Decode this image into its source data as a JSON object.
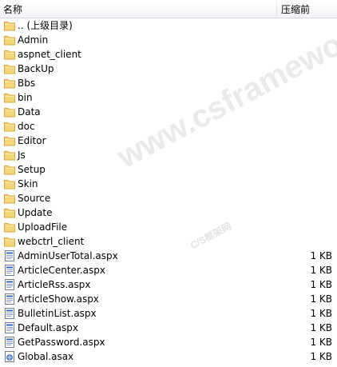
{
  "header": {
    "name_label": "名称",
    "size_label": "压缩前"
  },
  "folders": [
    ".. (上级目录)",
    "Admin",
    "aspnet_client",
    "BackUp",
    "Bbs",
    "bin",
    "Data",
    "doc",
    "Editor",
    "Js",
    "Setup",
    "Skin",
    "Source",
    "Update",
    "UploadFile",
    "webctrl_client"
  ],
  "files": [
    {
      "name": "AdminUserTotal.aspx",
      "size": "1 KB",
      "icon": "aspx-file-icon"
    },
    {
      "name": "ArticleCenter.aspx",
      "size": "1 KB",
      "icon": "aspx-file-icon"
    },
    {
      "name": "ArticleRss.aspx",
      "size": "1 KB",
      "icon": "aspx-file-icon"
    },
    {
      "name": "ArticleShow.aspx",
      "size": "1 KB",
      "icon": "aspx-file-icon"
    },
    {
      "name": "BulletinList.aspx",
      "size": "1 KB",
      "icon": "aspx-file-icon"
    },
    {
      "name": "Default.aspx",
      "size": "1 KB",
      "icon": "aspx-file-icon"
    },
    {
      "name": "GetPassword.aspx",
      "size": "1 KB",
      "icon": "aspx-file-icon"
    },
    {
      "name": "Global.asax",
      "size": "1 KB",
      "icon": "asax-file-icon"
    }
  ],
  "watermark": {
    "main": "www.csframework.com",
    "sub": "C/S框架网"
  },
  "colors": {
    "folder": "#f5d57a",
    "folder_edge": "#d9a93f",
    "file_line": "#3a6fc4"
  }
}
